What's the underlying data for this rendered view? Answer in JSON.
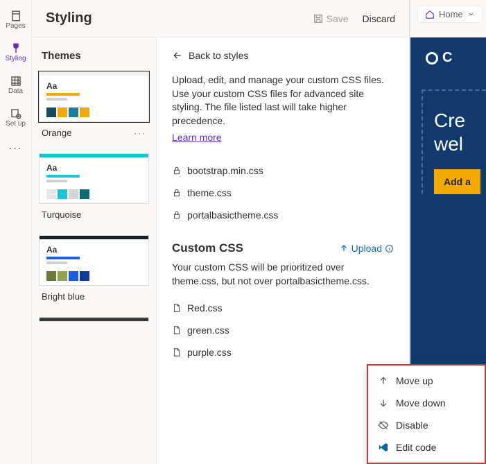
{
  "leftnav": {
    "items": [
      {
        "label": "Pages",
        "icon": "pages-icon"
      },
      {
        "label": "Styling",
        "icon": "brush-icon"
      },
      {
        "label": "Data",
        "icon": "data-icon"
      },
      {
        "label": "Set up",
        "icon": "setup-icon"
      }
    ],
    "active_index": 1,
    "more_label": "..."
  },
  "header": {
    "title": "Styling",
    "save_label": "Save",
    "discard_label": "Discard"
  },
  "themes": {
    "heading": "Themes",
    "items": [
      {
        "name": "Orange",
        "aa": "Aa",
        "accent_bar_primary": "#f2a900",
        "accent_bar_secondary": "#d0d0d0",
        "topbar": "#f3f2f1",
        "swatches": [
          "#1b4a5e",
          "#f2a900",
          "#1b7ea0",
          "#f2a900"
        ],
        "active": true,
        "show_overflow": true
      },
      {
        "name": "Turquoise",
        "aa": "Aa",
        "accent_bar_primary": "#1cc3d6",
        "accent_bar_secondary": "#d0d0d0",
        "topbar": "#1cc3d6",
        "swatches": [
          "#e6e6e6",
          "#1cc3d6",
          "#d6d6d6",
          "#0b6a73"
        ],
        "active": false,
        "show_overflow": false
      },
      {
        "name": "Bright blue",
        "aa": "Aa",
        "accent_bar_primary": "#1a5fe0",
        "accent_bar_secondary": "#d0d0d0",
        "topbar": "#17202a",
        "swatches": [
          "#6a7a3a",
          "#8fa24c",
          "#1a5fe0",
          "#0d3a9c"
        ],
        "active": false,
        "show_overflow": false
      }
    ]
  },
  "detail": {
    "back_label": "Back to styles",
    "desc": "Upload, edit, and manage your custom CSS files. Use your custom CSS files for advanced site styling. The file listed last will take higher precedence.",
    "learn_label": "Learn more",
    "system_files": [
      "bootstrap.min.css",
      "theme.css",
      "portalbasictheme.css"
    ],
    "custom_heading": "Custom CSS",
    "upload_label": "Upload",
    "custom_desc": "Your custom CSS will be prioritized over theme.css, but not over portalbasictheme.css.",
    "custom_files": [
      "Red.css",
      "green.css",
      "purple.css"
    ]
  },
  "preview": {
    "home_label": "Home",
    "logo_text": "C",
    "headline_line1": "Cre",
    "headline_line2": "wel",
    "cta": "Add a"
  },
  "context_menu": {
    "items": [
      {
        "label": "Move up",
        "icon": "arrow-up-icon"
      },
      {
        "label": "Move down",
        "icon": "arrow-down-icon"
      },
      {
        "label": "Disable",
        "icon": "disable-icon"
      },
      {
        "label": "Edit code",
        "icon": "vscode-icon"
      }
    ]
  }
}
